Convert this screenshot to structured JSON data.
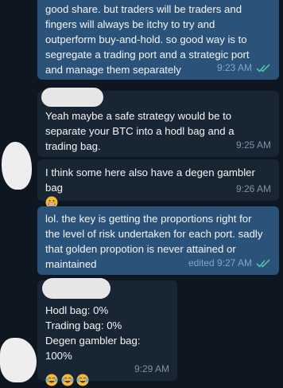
{
  "messages": [
    {
      "type": "outgoing",
      "text": "good share. but traders will be traders and\nfingers will always be itchy to try and\noutperform buy-and-hold. so good way is to\nsegregate a trading port and a strategic port\nand manage them separately",
      "time": "9:23 AM",
      "read": true
    },
    {
      "type": "incoming",
      "text": "Yeah maybe a safe strategy would be to\nseparate your BTC into a hodl bag and a\ntrading bag.",
      "time": "9:25 AM"
    },
    {
      "type": "incoming",
      "text": "I think some here also have a degen gambler\nbag",
      "time": "9:26 AM",
      "emoji": "grimacing-emoji"
    },
    {
      "type": "outgoing",
      "text": "lol. the key is getting the proportions right for\nthe level of risk undertaken for each port. sadly\nthat golden propotion is never attained or\nmaintained",
      "time": "edited 9:27 AM",
      "read": true
    },
    {
      "type": "incoming",
      "text": "Hodl bag: 0%\nTrading bag: 0%\nDegen gambler bag: 100%",
      "time": "9:29 AM",
      "emoji": "tears-of-joy-emoji x3"
    }
  ],
  "colors": {
    "background": "#0e1621",
    "outgoing_bubble": "#2b5278",
    "incoming_bubble": "#182533",
    "read_ticks": "#4fc3a1"
  }
}
